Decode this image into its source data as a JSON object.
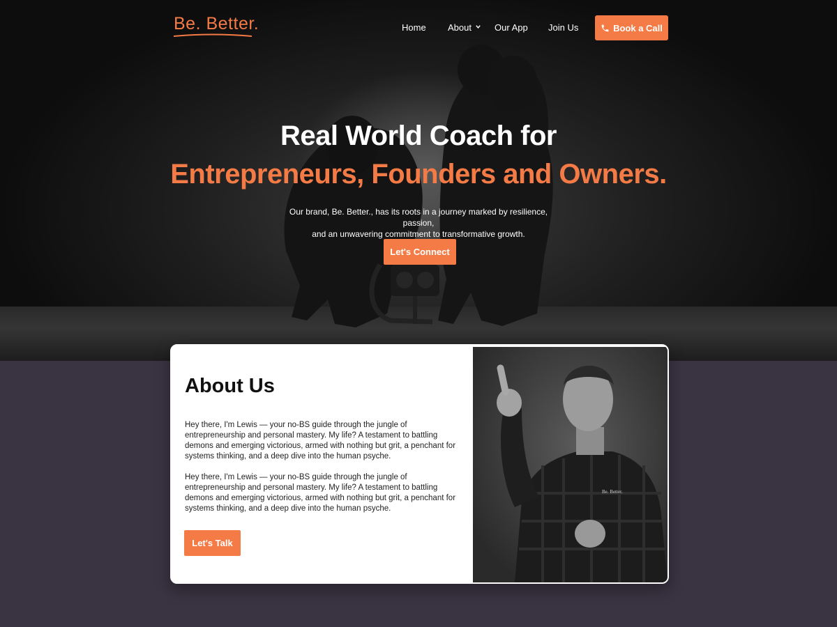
{
  "brand": {
    "logo_text": "Be. Better.",
    "accent_color": "#f47b45"
  },
  "nav": {
    "items": [
      {
        "label": "Home"
      },
      {
        "label": "About",
        "has_dropdown": true
      },
      {
        "label": "Our App"
      },
      {
        "label": "Join Us"
      }
    ],
    "cta": {
      "label": "Book a Call",
      "icon": "phone-icon"
    }
  },
  "hero": {
    "title": "Real World Coach for",
    "subtitle": "Entrepreneurs, Founders and Owners.",
    "description_line1": "Our brand, Be. Better., has its roots in a journey marked by resilience, passion,",
    "description_line2": "and an unwavering commitment to transformative growth.",
    "cta_label": "Let's Connect"
  },
  "about": {
    "title": "About Us",
    "paragraphs": [
      "Hey there, I'm Lewis — your no-BS guide through the jungle of entrepreneurship and personal mastery. My life? A testament to battling demons and emerging victorious, armed with nothing but grit, a penchant for systems thinking, and a deep dive into the human psyche.",
      "Hey there, I'm Lewis — your no-BS guide through the jungle of entrepreneurship and personal mastery. My life? A testament to battling demons and emerging victorious, armed with nothing but grit, a penchant for systems thinking, and a deep dive into the human psyche."
    ],
    "cta_label": "Let's Talk",
    "shirt_logo_text": "Be. Better."
  }
}
